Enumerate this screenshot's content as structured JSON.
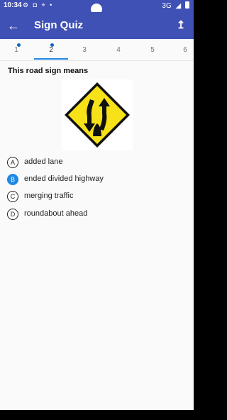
{
  "status_bar": {
    "time": "10:34",
    "left_icons": "⚙ ◘ ⌖ •",
    "network": "3G"
  },
  "app_bar": {
    "back_icon": "arrow-left-icon",
    "title": "Sign Quiz",
    "share_icon": "share-icon"
  },
  "tabs": [
    {
      "label": "1",
      "answered": true
    },
    {
      "label": "2",
      "answered": true,
      "selected": true
    },
    {
      "label": "3"
    },
    {
      "label": "4"
    },
    {
      "label": "5"
    },
    {
      "label": "6"
    }
  ],
  "question": {
    "text": "This road sign means",
    "sign": "end-of-divided-highway-sign"
  },
  "options": [
    {
      "letter": "A",
      "text": "added lane",
      "selected": false
    },
    {
      "letter": "B",
      "text": "ended divided highway",
      "selected": true
    },
    {
      "letter": "C",
      "text": "merging traffic",
      "selected": false
    },
    {
      "letter": "D",
      "text": "roundabout ahead",
      "selected": false
    }
  ],
  "colors": {
    "primary": "#3f51b5",
    "accent": "#1e88e5",
    "sign_yellow": "#f7e21a"
  }
}
